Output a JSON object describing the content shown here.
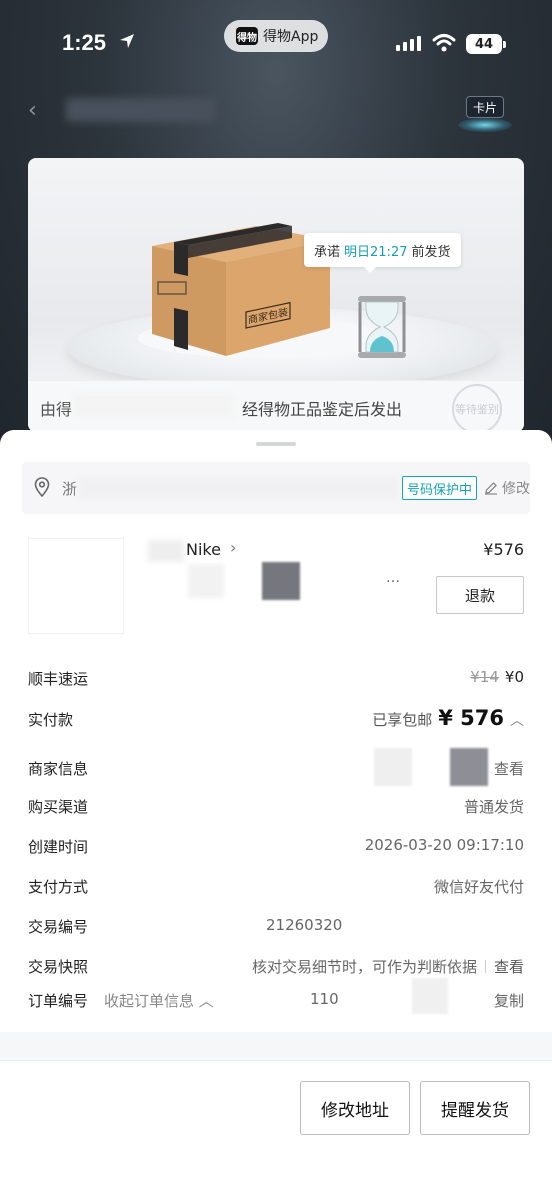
{
  "status_bar": {
    "time": "1:25",
    "app_pill": "得物App",
    "app_logo": "得物",
    "battery": "44"
  },
  "header": {
    "card_badge": "卡片"
  },
  "hero": {
    "promise_prefix": "承诺",
    "promise_time": "明日21:27",
    "promise_suffix": "前发货",
    "box_label": "商家包装",
    "footer_left": "由得",
    "footer_text": "经得物正品鉴定后发出",
    "seal_text": "等待鉴别"
  },
  "address": {
    "prefix": "浙",
    "protect_tag": "号码保护中",
    "edit_label": "修改"
  },
  "product": {
    "name_fragment": "Nike",
    "chevron": "›",
    "price": "¥576",
    "spec_more": "…",
    "refund_label": "退款"
  },
  "rows": {
    "shipping": {
      "label": "顺丰速运",
      "original": "¥14",
      "current": "¥0"
    },
    "paid": {
      "label": "实付款",
      "note": "已享包邮",
      "amount": "¥ 576",
      "toggle": "︿"
    },
    "merchant": {
      "label": "商家信息",
      "action": "查看"
    },
    "channel": {
      "label": "购买渠道",
      "value": "普通发货"
    },
    "created": {
      "label": "创建时间",
      "value": "2026-03-20 09:17:10"
    },
    "payment": {
      "label": "支付方式",
      "value": "微信好友代付"
    },
    "trade_no": {
      "label": "交易编号",
      "value": "21260320"
    },
    "snapshot": {
      "label": "交易快照",
      "value": "核对交易细节时，可作为判断依据",
      "action": "查看"
    },
    "order_no": {
      "label": "订单编号",
      "collapse": "收起订单信息 ︿",
      "value": "110",
      "action": "复制"
    }
  },
  "actions": {
    "change_address": "修改地址",
    "remind_ship": "提醒发货"
  },
  "colors": {
    "accent": "#15a4b4",
    "dark_bg": "#2a3038"
  }
}
